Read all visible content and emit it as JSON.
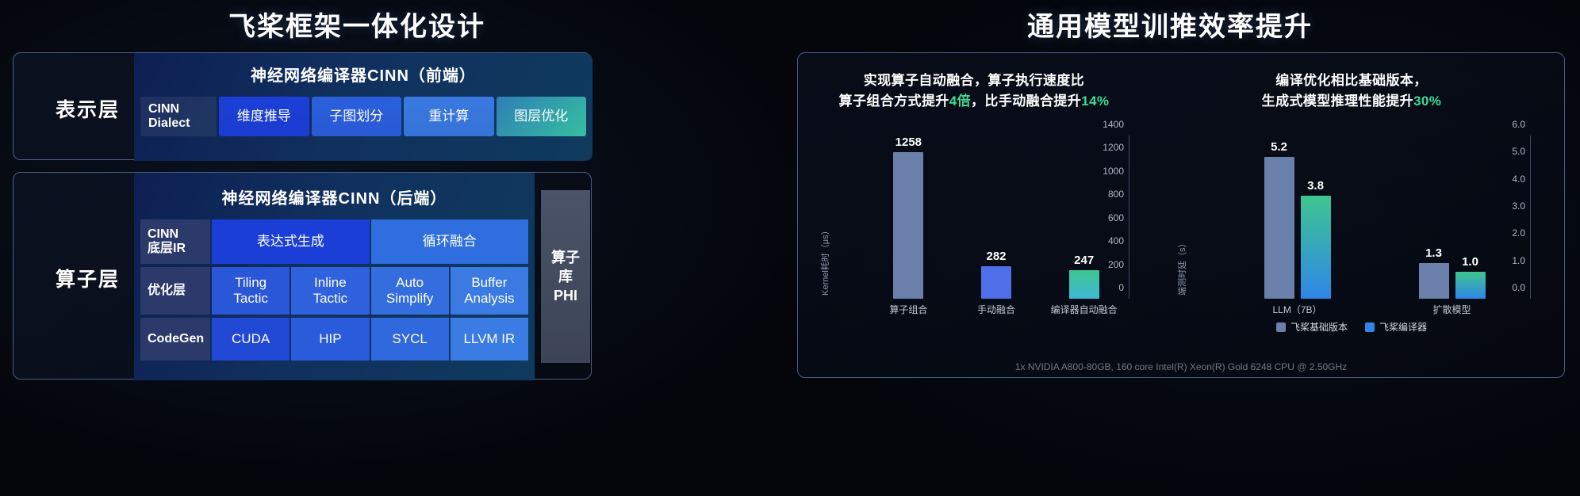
{
  "left": {
    "title": "飞桨框架一体化设计",
    "presentation_layer": {
      "layer_label": "表示层",
      "stack_title": "神经网络编译器CINN（前端）",
      "side_label": "CINN\nDialect",
      "cells": [
        "维度推导",
        "子图划分",
        "重计算",
        "图层优化"
      ]
    },
    "operator_layer": {
      "layer_label": "算子层",
      "stack_title": "神经网络编译器CINN（后端）",
      "rows": [
        {
          "side": "CINN\n底层IR",
          "cells": [
            "表达式生成",
            "循环融合"
          ]
        },
        {
          "side": "优化层",
          "cells": [
            "Tiling\nTactic",
            "Inline\nTactic",
            "Auto\nSimplify",
            "Buffer\nAnalysis"
          ]
        },
        {
          "side": "CodeGen",
          "cells": [
            "CUDA",
            "HIP",
            "SYCL",
            "LLVM IR"
          ]
        }
      ],
      "phi_box": "算子\n库\nPHI"
    }
  },
  "right": {
    "title": "通用模型训推效率提升",
    "footnote": "1x NVIDIA A800-80GB, 160 core Intel(R) Xeon(R) Gold 6248 CPU @ 2.50GHz",
    "caption_left_line1": "实现算子自动融合，算子执行速度比",
    "caption_left_line2_a": "算子组合方式提升",
    "caption_left_line2_accent1": "4倍",
    "caption_left_line2_b": "，比手动融合提升",
    "caption_left_line2_accent2": "14%",
    "caption_right_line1": "编译优化相比基础版本，",
    "caption_right_line2_a": "生成式模型推理性能提升",
    "caption_right_line2_accent": "30%",
    "colors": {
      "accent_green": "#3ddc9a",
      "bar_grey_blue": "#6b7fab",
      "bar_blue": "#4e6fe8",
      "bar_teal_gradient_start": "#3dc58f",
      "bar_teal_gradient_end": "#3fb8d6"
    }
  },
  "chart_data": [
    {
      "type": "bar",
      "id": "kernel-latency-chart",
      "title": "",
      "categories": [
        "算子组合",
        "手动融合",
        "编译器自动融合"
      ],
      "values": [
        1258,
        282,
        247
      ],
      "data_labels": [
        "1258",
        "282",
        "247"
      ],
      "xlabel": "",
      "ylabel": "Kernel耗时（μs）",
      "ylim": [
        0,
        1400
      ],
      "yticks": [
        0,
        200,
        400,
        600,
        800,
        1000,
        1200,
        1400
      ],
      "ytick_labels": [
        "0",
        "200",
        "400",
        "600",
        "800",
        "1000",
        "1200",
        "1400"
      ],
      "bar_colors": [
        "#6b7fab",
        "#4e6fe8",
        "linear-gradient(180deg,#3dc58f,#3fb8d6)"
      ],
      "grid": false,
      "legend": "none"
    },
    {
      "type": "bar",
      "id": "inference-latency-chart",
      "title": "",
      "categories": [
        "LLM（7B）",
        "扩散模型"
      ],
      "series": [
        {
          "name": "飞桨基础版本",
          "values": [
            5.2,
            1.3
          ],
          "color": "#6b7fab"
        },
        {
          "name": "飞桨编译器",
          "values": [
            3.8,
            1.0
          ],
          "color": "linear-gradient(180deg,#3dc58f,#2f86e8)"
        }
      ],
      "data_labels": [
        [
          "5.2",
          "3.8"
        ],
        [
          "1.3",
          "1.0"
        ]
      ],
      "xlabel": "",
      "ylabel": "端测时延（s）",
      "ylim": [
        0,
        6.0
      ],
      "yticks": [
        0.0,
        1.0,
        2.0,
        3.0,
        4.0,
        5.0,
        6.0
      ],
      "ytick_labels": [
        "0.0",
        "1.0",
        "2.0",
        "3.0",
        "4.0",
        "5.0",
        "6.0"
      ],
      "grid": false,
      "legend": "bottom-center",
      "legend_entries": [
        "飞桨基础版本",
        "飞桨编译器"
      ]
    }
  ]
}
